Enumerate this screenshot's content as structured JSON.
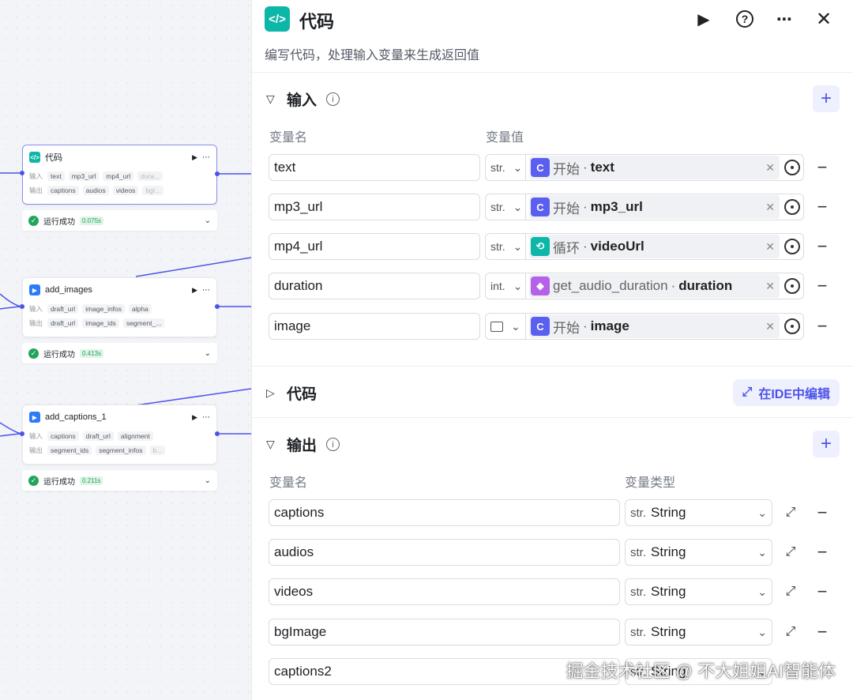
{
  "canvas": {
    "nodes": [
      {
        "title": "代码",
        "icon": "code-icon",
        "icon_color": "#0db7a8",
        "rows": [
          {
            "k": "输入",
            "tags": [
              "text",
              "mp3_url",
              "mp4_url",
              "dura..."
            ]
          },
          {
            "k": "输出",
            "tags": [
              "captions",
              "audios",
              "videos",
              "bgI..."
            ]
          }
        ],
        "status": "运行成功",
        "time": "0.075s"
      },
      {
        "title": "add_images",
        "icon": "plugin-icon",
        "icon_color": "#2d7cf6",
        "rows": [
          {
            "k": "输入",
            "tags": [
              "draft_url",
              "image_infos",
              "alpha"
            ]
          },
          {
            "k": "输出",
            "tags": [
              "draft_url",
              "image_ids",
              "segment_..."
            ]
          }
        ],
        "status": "运行成功",
        "time": "0.413s"
      },
      {
        "title": "add_captions_1",
        "icon": "plugin-icon",
        "icon_color": "#2d7cf6",
        "rows": [
          {
            "k": "输入",
            "tags": [
              "captions",
              "draft_url",
              "alignment"
            ]
          },
          {
            "k": "输出",
            "tags": [
              "segment_ids",
              "segment_infos",
              "b..."
            ]
          }
        ],
        "status": "运行成功",
        "time": "0.211s"
      }
    ]
  },
  "panel": {
    "title": "代码",
    "description": "编写代码，处理输入变量来生成返回值",
    "header_icons": [
      "run-icon",
      "help-icon",
      "more-icon",
      "close-icon"
    ],
    "input": {
      "title": "输入",
      "col_name": "变量名",
      "col_value": "变量值",
      "rows": [
        {
          "name": "text",
          "type": "str.",
          "ref_node": "开始",
          "ref_var": "text",
          "ref_icon_color": "#5a5ff0",
          "ref_icon": "start-icon"
        },
        {
          "name": "mp3_url",
          "type": "str.",
          "ref_node": "开始",
          "ref_var": "mp3_url",
          "ref_icon_color": "#5a5ff0",
          "ref_icon": "start-icon"
        },
        {
          "name": "mp4_url",
          "type": "str.",
          "ref_node": "循环",
          "ref_var": "videoUrl",
          "ref_icon_color": "#0db7a8",
          "ref_icon": "loop-icon"
        },
        {
          "name": "duration",
          "type": "int.",
          "ref_node": "get_audio_duration",
          "ref_var": "duration",
          "ref_icon_color": "#b562e8",
          "ref_icon": "plugin-cube-icon"
        },
        {
          "name": "image",
          "type": "",
          "ref_node": "开始",
          "ref_var": "image",
          "ref_icon_color": "#5a5ff0",
          "ref_icon": "start-icon"
        }
      ]
    },
    "code": {
      "title": "代码",
      "ide_button": "在IDE中编辑"
    },
    "output": {
      "title": "输出",
      "col_name": "变量名",
      "col_type": "变量类型",
      "rows": [
        {
          "name": "captions",
          "type_prefix": "str.",
          "type": "String"
        },
        {
          "name": "audios",
          "type_prefix": "str.",
          "type": "String"
        },
        {
          "name": "videos",
          "type_prefix": "str.",
          "type": "String"
        },
        {
          "name": "bgImage",
          "type_prefix": "str.",
          "type": "String"
        },
        {
          "name": "captions2",
          "type_prefix": "str.",
          "type": "String"
        }
      ]
    }
  },
  "watermark": "掘金技术社区 @ 不大姐姐AI智能体"
}
